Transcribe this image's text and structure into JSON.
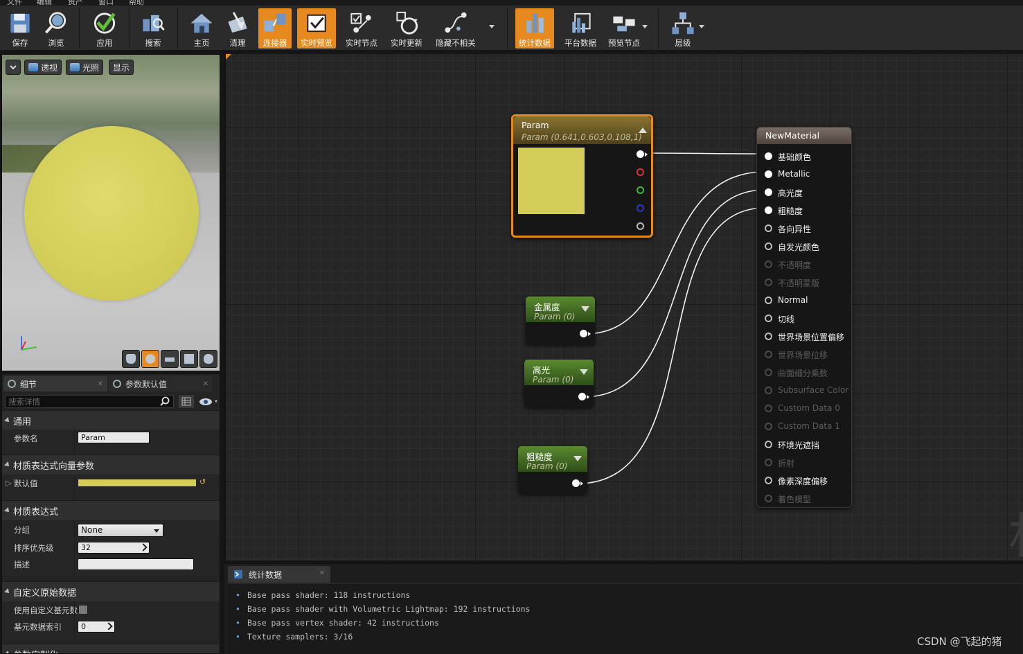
{
  "menubar": {
    "items": [
      "文件",
      "编辑",
      "资产",
      "窗口",
      "帮助"
    ]
  },
  "toolbar": {
    "buttons": [
      {
        "label": "保存",
        "icon": "save-icon"
      },
      {
        "label": "浏览",
        "icon": "browse-icon"
      },
      {
        "label": "应用",
        "icon": "apply-icon"
      },
      {
        "label": "搜索",
        "icon": "search-icon"
      },
      {
        "label": "主页",
        "icon": "home-icon"
      },
      {
        "label": "清理",
        "icon": "clean-icon"
      },
      {
        "label": "连接器",
        "icon": "connector-icon",
        "active": true
      },
      {
        "label": "实时预览",
        "icon": "live-preview-icon",
        "active": true
      },
      {
        "label": "实时节点",
        "icon": "live-nodes-icon"
      },
      {
        "label": "实时更新",
        "icon": "live-update-icon"
      },
      {
        "label": "隐藏不相关",
        "icon": "hide-unrelated-icon"
      },
      {
        "label": "统计数据",
        "icon": "stats-icon",
        "active": true
      },
      {
        "label": "平台数据",
        "icon": "platform-stats-icon"
      },
      {
        "label": "预览节点",
        "icon": "preview-node-icon"
      },
      {
        "label": "层级",
        "icon": "hierarchy-icon"
      }
    ]
  },
  "viewport": {
    "buttons": [
      "透视",
      "光照",
      "显示"
    ],
    "sphere_color": "#d4cf5a"
  },
  "details": {
    "tab_details": "细节",
    "tab_param_defaults": "参数默认值",
    "search_placeholder": "搜索详情",
    "cat_general": "通用",
    "prop_param_name": "参数名",
    "val_param_name": "Param",
    "cat_vector_param": "材质表达式向量参数",
    "prop_default_value": "默认值",
    "default_color": "#d4cd5a",
    "cat_expression": "材质表达式",
    "prop_group": "分组",
    "val_group": "None",
    "prop_sort_priority": "排序优先级",
    "val_sort_priority": "32",
    "prop_desc": "描述",
    "cat_custom_primitive": "自定义原始数据",
    "prop_use_custom_primitive": "使用自定义基元数",
    "prop_primitive_index": "基元数据索引",
    "val_primitive_index": "0",
    "cat_param_custom": "参数定制化"
  },
  "graph": {
    "param_node": {
      "title": "Param",
      "subtitle": "Param (0.641,0.603,0.108,1)",
      "swatch": "#d4cd5a"
    },
    "metal_node": {
      "title": "金属度",
      "subtitle": "Param (0)"
    },
    "spec_node": {
      "title": "高光",
      "subtitle": "Param (0)"
    },
    "rough_node": {
      "title": "粗糙度",
      "subtitle": "Param (0)"
    },
    "material": {
      "title": "NewMaterial",
      "pins": [
        {
          "label": "基础颜色",
          "state": "connected"
        },
        {
          "label": "Metallic",
          "state": "connected"
        },
        {
          "label": "高光度",
          "state": "connected"
        },
        {
          "label": "粗糙度",
          "state": "connected"
        },
        {
          "label": "各向异性",
          "state": "open"
        },
        {
          "label": "自发光颜色",
          "state": "open"
        },
        {
          "label": "不透明度",
          "state": "disabled"
        },
        {
          "label": "不透明蒙版",
          "state": "disabled"
        },
        {
          "label": "Normal",
          "state": "open"
        },
        {
          "label": "切线",
          "state": "open"
        },
        {
          "label": "世界场景位置偏移",
          "state": "open"
        },
        {
          "label": "世界场景位移",
          "state": "disabled"
        },
        {
          "label": "曲面细分乘数",
          "state": "disabled"
        },
        {
          "label": "Subsurface Color",
          "state": "disabled"
        },
        {
          "label": "Custom Data 0",
          "state": "disabled"
        },
        {
          "label": "Custom Data 1",
          "state": "disabled"
        },
        {
          "label": "环境光遮挡",
          "state": "open"
        },
        {
          "label": "折射",
          "state": "disabled"
        },
        {
          "label": "像素深度偏移",
          "state": "open"
        },
        {
          "label": "着色模型",
          "state": "disabled"
        }
      ]
    },
    "watermark_char": "村"
  },
  "stats": {
    "tab": "统计数据",
    "lines": [
      "Base pass shader: 118 instructions",
      "Base pass shader with Volumetric Lightmap: 192 instructions",
      "Base pass vertex shader: 42 instructions",
      "Texture samplers: 3/16"
    ]
  },
  "credit": "CSDN @飞起的猪",
  "colors": {
    "accent": "#e68a1f",
    "param_header": "#6b5a26",
    "scalar_header": "#3f6b20",
    "material_header": "#6b5e55"
  }
}
